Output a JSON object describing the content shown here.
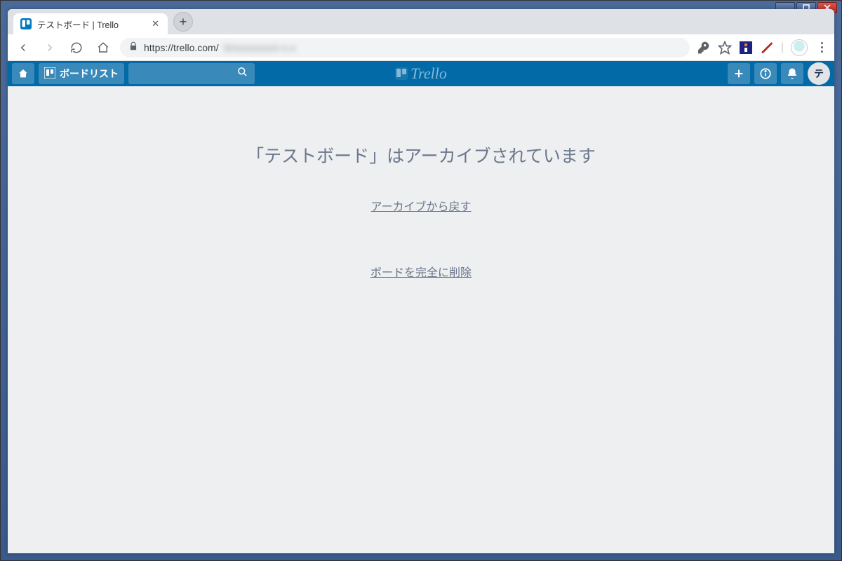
{
  "window": {
    "min_label": "minimize",
    "max_label": "maximize",
    "close_label": "close"
  },
  "tab": {
    "title": "テストボード | Trello"
  },
  "addressbar": {
    "url": "https://trello.com/",
    "url_hidden": "b/xxxxxxxx/x-x-x"
  },
  "trello_header": {
    "boardlist_label": "ボードリスト",
    "logo_text": "Trello",
    "avatar_initial": "テ"
  },
  "content": {
    "archived_title": "「テストボード」はアーカイブされています",
    "restore_link": "アーカイブから戻す",
    "delete_link": "ボードを完全に削除"
  }
}
